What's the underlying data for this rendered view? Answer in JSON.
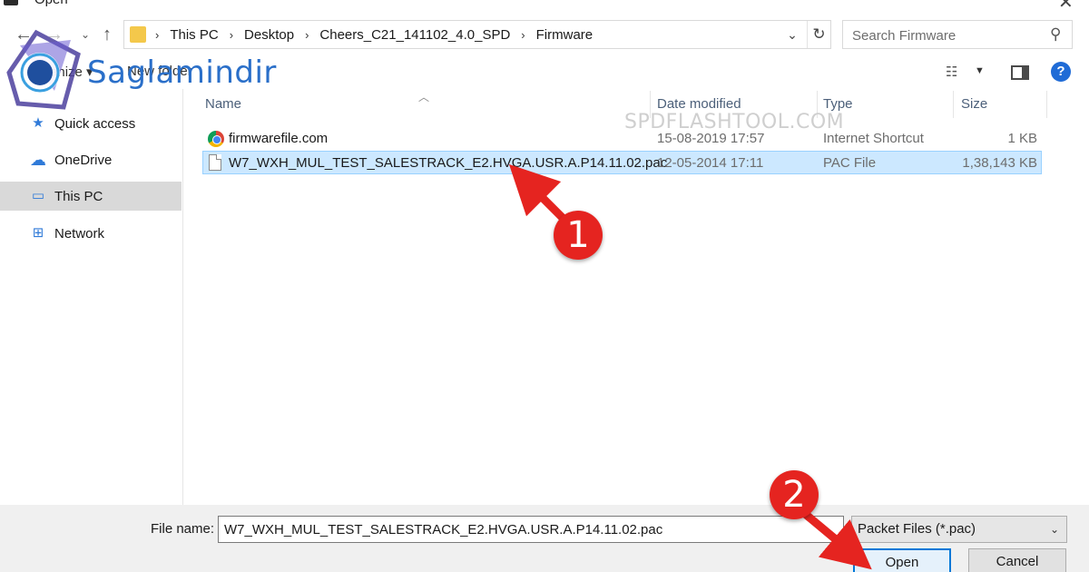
{
  "window": {
    "title": "Open"
  },
  "address": {
    "crumbs": [
      "This PC",
      "Desktop",
      "Cheers_C21_141102_4.0_SPD",
      "Firmware"
    ]
  },
  "search": {
    "placeholder": "Search Firmware"
  },
  "toolbar": {
    "organize_label": "Organize ▾",
    "new_folder_label": "New folder"
  },
  "logo": {
    "text": "Saglamindir"
  },
  "sidebar": {
    "items": [
      {
        "label": "Quick access",
        "icon": "star-icon"
      },
      {
        "label": "OneDrive",
        "icon": "cloud-icon"
      },
      {
        "label": "This PC",
        "icon": "monitor-icon",
        "selected": true
      },
      {
        "label": "Network",
        "icon": "network-icon"
      }
    ]
  },
  "columns": {
    "name": "Name",
    "date": "Date modified",
    "type": "Type",
    "size": "Size"
  },
  "watermark": "SPDFLASHTOOL.COM",
  "files": [
    {
      "name": "firmwarefile.com",
      "date": "15-08-2019 17:57",
      "type": "Internet Shortcut",
      "size": "1 KB",
      "icon": "chrome-icon"
    },
    {
      "name": "W7_WXH_MUL_TEST_SALESTRACK_E2.HVGA.USR.A.P14.11.02.pac",
      "date": "12-05-2014 17:11",
      "type": "PAC File",
      "size": "1,38,143 KB",
      "icon": "pac-file-icon",
      "selected": true
    }
  ],
  "bottom": {
    "file_name_label": "File name:",
    "file_name_value": "W7_WXH_MUL_TEST_SALESTRACK_E2.HVGA.USR.A.P14.11.02.pac",
    "file_type": "Packet Files (*.pac)",
    "open_label": "Open",
    "cancel_label": "Cancel"
  },
  "annotations": {
    "step1": "1",
    "step2": "2"
  },
  "colors": {
    "selection_bg": "#cce8ff",
    "accent": "#0078d7",
    "annotation": "#e52420",
    "logo": "#2a6fc9"
  }
}
